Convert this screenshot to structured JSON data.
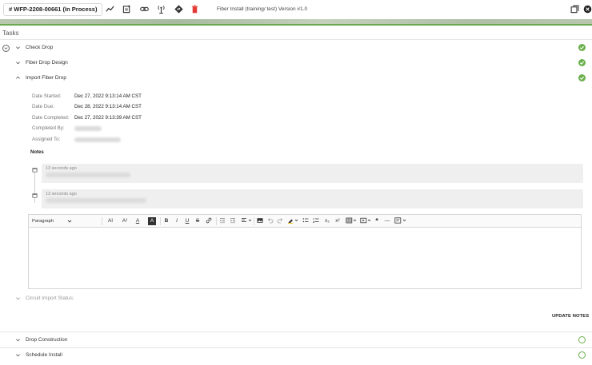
{
  "header": {
    "work_order": "# WFP-2208-00661 (In Process)",
    "title": "Fiber Install (training/ test) Version #1.0",
    "icons": [
      "chart-line-icon",
      "add-note-icon",
      "link-icon",
      "antenna-icon",
      "directions-icon",
      "delete-icon",
      "window-icon",
      "close-icon"
    ],
    "colors": {
      "delete": "#e53935",
      "success": "#6ab04c"
    }
  },
  "tasks": {
    "title": "Tasks",
    "items": [
      {
        "label": "Check Drop",
        "status": "complete"
      },
      {
        "label": "Fiber Drop Design",
        "status": "complete"
      },
      {
        "label": "Import Fiber Drop",
        "status": "complete",
        "expanded": true
      },
      {
        "label": "Drop Construction",
        "status": "open"
      },
      {
        "label": "Schedule Install",
        "status": "open"
      }
    ]
  },
  "details": {
    "date_started_label": "Date Started:",
    "date_started": "Dec 27, 2022 9:13:14 AM CST",
    "date_due_label": "Date Due:",
    "date_due": "Dec 28, 2022 9:13:14 AM CST",
    "date_completed_label": "Date Completed:",
    "date_completed": "Dec 27, 2022 9:13:39 AM CST",
    "completed_by_label": "Completed By:",
    "assigned_to_label": "Assigned To:"
  },
  "notes": {
    "label": "Notes",
    "entries": [
      {
        "time": "13 seconds ago"
      },
      {
        "time": "13 seconds ago"
      }
    ]
  },
  "editor": {
    "paragraph_select": "Paragraph",
    "tools": [
      "AI",
      "A²",
      "A",
      "A",
      "B",
      "I",
      "U",
      "S",
      "link",
      "outdent",
      "indent",
      "align",
      "image",
      "undo",
      "redo",
      "highlight",
      "bullets",
      "numbering",
      "x₂",
      "x²",
      "table",
      "media",
      "❝",
      "—",
      "template"
    ]
  },
  "circuit": {
    "label": "Circuit Import Status:"
  },
  "actions": {
    "update_notes": "UPDATE NOTES"
  }
}
